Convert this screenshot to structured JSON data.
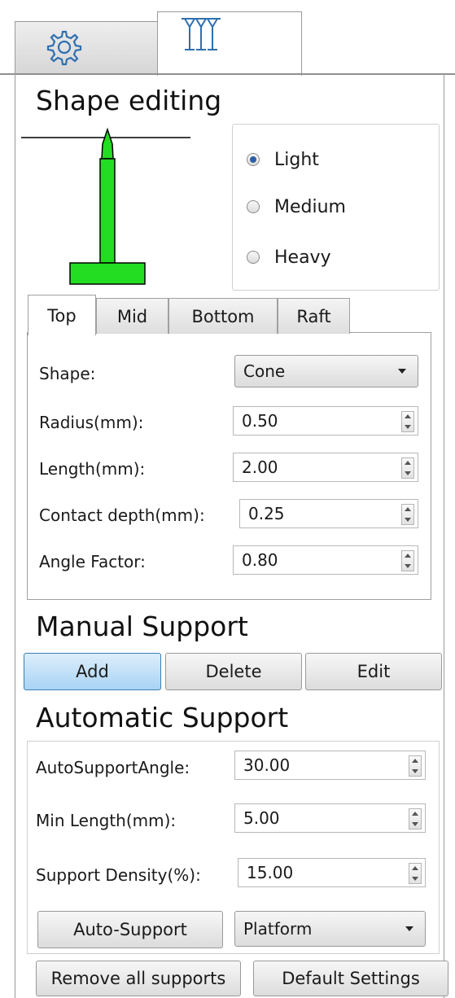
{
  "tabs": [
    {
      "name": "settings",
      "icon": "gear-icon"
    },
    {
      "name": "supports",
      "icon": "support-pillars-icon"
    }
  ],
  "shape_editing": {
    "title": "Shape editing",
    "density_options": [
      {
        "label": "Light",
        "checked": true
      },
      {
        "label": "Medium",
        "checked": false
      },
      {
        "label": "Heavy",
        "checked": false
      }
    ],
    "subtabs": [
      "Top",
      "Mid",
      "Bottom",
      "Raft"
    ],
    "active_subtab": "Top",
    "fields": {
      "shape": {
        "label": "Shape:",
        "value": "Cone"
      },
      "radius": {
        "label": "Radius(mm):",
        "value": "0.50"
      },
      "length": {
        "label": "Length(mm):",
        "value": "2.00"
      },
      "contact_depth": {
        "label": "Contact depth(mm):",
        "value": "0.25"
      },
      "angle_factor": {
        "label": "Angle Factor:",
        "value": "0.80"
      }
    }
  },
  "manual_support": {
    "title": "Manual Support",
    "add_label": "Add",
    "delete_label": "Delete",
    "edit_label": "Edit"
  },
  "automatic_support": {
    "title": "Automatic Support",
    "fields": {
      "angle": {
        "label": "AutoSupportAngle:",
        "value": "30.00"
      },
      "min_length": {
        "label": "Min Length(mm):",
        "value": "5.00"
      },
      "density": {
        "label": "Support Density(%):",
        "value": "15.00"
      }
    },
    "auto_support_label": "Auto-Support",
    "target": "Platform"
  },
  "footer": {
    "remove_all_label": "Remove all supports",
    "default_settings_label": "Default Settings"
  },
  "colors": {
    "support_green": "#22dd22",
    "accent_blue": "#2e5fa6"
  }
}
